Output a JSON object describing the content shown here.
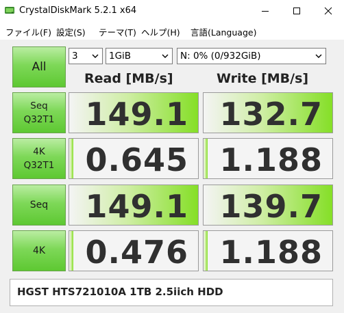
{
  "window": {
    "title": "CrystalDiskMark 5.2.1 x64",
    "app_icon": "disk-icon"
  },
  "menu": {
    "file": "ファイル(F)",
    "settings": "設定(S)",
    "theme": "テーマ(T)",
    "help": "ヘルプ(H)",
    "language": "言語(Language)"
  },
  "controls": {
    "all_label": "All",
    "count": "3",
    "size": "1GiB",
    "drive": "N: 0% (0/932GiB)"
  },
  "headers": {
    "read": "Read [MB/s]",
    "write": "Write [MB/s]"
  },
  "tests": [
    {
      "label_line1": "Seq",
      "label_line2": "Q32T1",
      "read": "149.1",
      "write": "132.7",
      "read_fill": 1.0,
      "write_fill": 1.0
    },
    {
      "label_line1": "4K",
      "label_line2": "Q32T1",
      "read": "0.645",
      "write": "1.188",
      "read_fill": 0.03,
      "write_fill": 0.03
    },
    {
      "label_line1": "Seq",
      "label_line2": "",
      "read": "149.1",
      "write": "139.7",
      "read_fill": 1.0,
      "write_fill": 1.0
    },
    {
      "label_line1": "4K",
      "label_line2": "",
      "read": "0.476",
      "write": "1.188",
      "read_fill": 0.03,
      "write_fill": 0.03
    }
  ],
  "comment": "HGST HTS721010A 1TB 2.5iich HDD",
  "colors": {
    "button_green": "#7ed858",
    "bar_green": "#85df27",
    "value_text": "#303030"
  }
}
